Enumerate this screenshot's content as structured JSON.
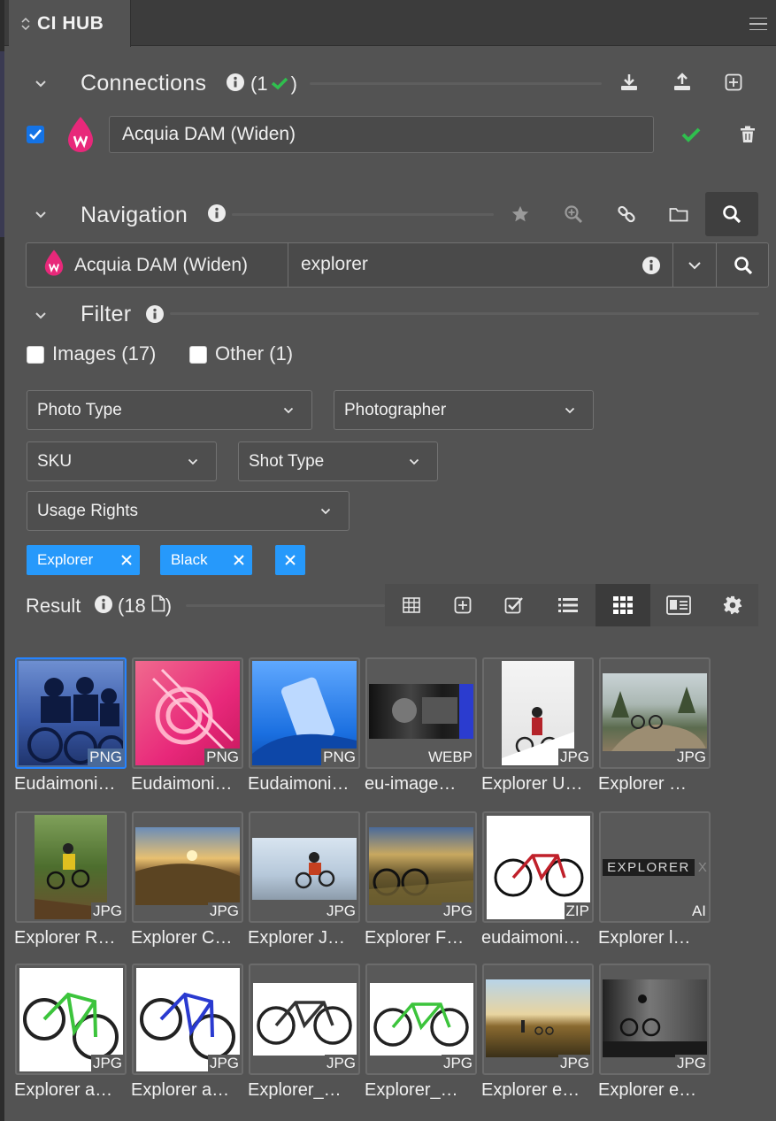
{
  "app": {
    "title": "CI HUB"
  },
  "connections": {
    "title": "Connections",
    "count_prefix": "(1",
    "count_suffix": ")",
    "item": {
      "name": "Acquia DAM (Widen)",
      "checked": true
    }
  },
  "navigation": {
    "title": "Navigation",
    "source_label": "Acquia DAM (Widen)",
    "search_value": "explorer"
  },
  "filter": {
    "title": "Filter",
    "checkboxes": [
      {
        "label": "Images (17)",
        "checked": false
      },
      {
        "label": "Other (1)",
        "checked": false
      }
    ],
    "dropdowns": [
      {
        "label": "Photo Type"
      },
      {
        "label": "Photographer"
      },
      {
        "label": "SKU"
      },
      {
        "label": "Shot Type"
      },
      {
        "label": "Usage Rights"
      }
    ],
    "tags": [
      {
        "label": "Explorer"
      },
      {
        "label": "Black"
      }
    ]
  },
  "result": {
    "title": "Result",
    "count_prefix": "(18",
    "count_suffix": ")",
    "items": [
      {
        "name": "Eudaimoni…",
        "ext": "PNG",
        "selected": true
      },
      {
        "name": "Eudaimoni…",
        "ext": "PNG"
      },
      {
        "name": "Eudaimoni…",
        "ext": "PNG"
      },
      {
        "name": "eu-image…",
        "ext": "WEBP"
      },
      {
        "name": "Explorer U…",
        "ext": "JPG"
      },
      {
        "name": "Explorer …",
        "ext": "JPG"
      },
      {
        "name": "Explorer R…",
        "ext": "JPG"
      },
      {
        "name": "Explorer C…",
        "ext": "JPG"
      },
      {
        "name": "Explorer J…",
        "ext": "JPG"
      },
      {
        "name": "Explorer F…",
        "ext": "JPG"
      },
      {
        "name": "eudaimoni…",
        "ext": "ZIP"
      },
      {
        "name": "Explorer l…",
        "ext": "AI",
        "thumb_text": "EXPLORER",
        "thumb_text_suffix": "X"
      },
      {
        "name": "Explorer a…",
        "ext": "JPG"
      },
      {
        "name": "Explorer a…",
        "ext": "JPG"
      },
      {
        "name": "Explorer_…",
        "ext": "JPG"
      },
      {
        "name": "Explorer_…",
        "ext": "JPG"
      },
      {
        "name": "Explorer e…",
        "ext": "JPG"
      },
      {
        "name": "Explorer e…",
        "ext": "JPG"
      }
    ]
  },
  "colors": {
    "accent": "#2699fb",
    "check_green": "#2fbf4e",
    "acquia_pink": "#e8287a"
  }
}
